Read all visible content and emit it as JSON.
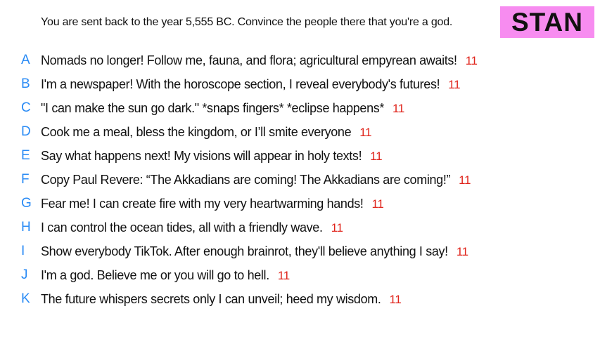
{
  "prompt": "You are sent back to the year 5,555 BC. Convince the people there that you're a god.",
  "player_name": "STAN",
  "colors": {
    "badge": "#f78cf0",
    "letter": "#2a8bf5",
    "votes": "#e0241b"
  },
  "options": [
    {
      "letter": "A",
      "text": "Nomads no longer! Follow me, fauna, and flora; agricultural empyrean awaits!",
      "votes": "11"
    },
    {
      "letter": "B",
      "text": "I'm a newspaper! With the horoscope section, I reveal everybody's futures!",
      "votes": "11"
    },
    {
      "letter": "C",
      "text": "\"I can make the sun go dark.\" *snaps fingers* *eclipse happens*",
      "votes": "11"
    },
    {
      "letter": "D",
      "text": "Cook me a meal, bless the kingdom, or I’ll smite everyone",
      "votes": "11"
    },
    {
      "letter": "E",
      "text": "Say what happens next! My visions will appear in holy texts!",
      "votes": "11"
    },
    {
      "letter": "F",
      "text": "Copy Paul Revere: “The Akkadians are coming! The Akkadians are coming!”",
      "votes": "11"
    },
    {
      "letter": "G",
      "text": "Fear me! I can create fire with my very heartwarming hands!",
      "votes": "11"
    },
    {
      "letter": "H",
      "text": "I can control the ocean tides, all with a friendly wave.",
      "votes": "11"
    },
    {
      "letter": "I",
      "text": "Show everybody TikTok. After enough brainrot, they'll believe anything I say!",
      "votes": "11"
    },
    {
      "letter": "J",
      "text": "I'm a god. Believe me or you will go to hell.",
      "votes": "11"
    },
    {
      "letter": "K",
      "text": "The future whispers secrets only I can unveil; heed my wisdom.",
      "votes": "11"
    }
  ]
}
